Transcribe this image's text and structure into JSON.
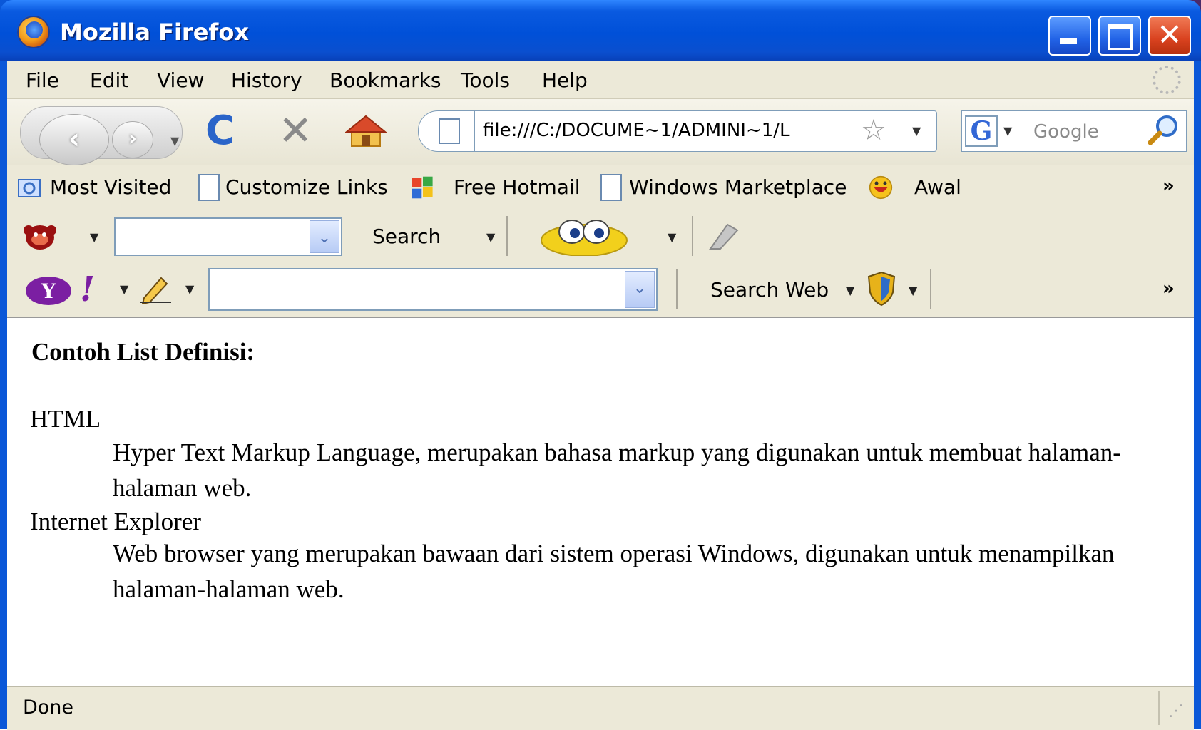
{
  "window": {
    "title": "Mozilla Firefox",
    "close_glyph": "✕"
  },
  "menu": {
    "items": [
      "File",
      "Edit",
      "View",
      "History",
      "Bookmarks",
      "Tools",
      "Help"
    ]
  },
  "nav": {
    "back_glyph": "‹",
    "forward_glyph": "›",
    "reload_glyph": "C",
    "stop_glyph": "✕",
    "url": "file:///C:/DOCUME~1/ADMINI~1/L",
    "star_glyph": "☆",
    "search_engine_glyph": "G",
    "search_placeholder": "Google"
  },
  "bookmarks": {
    "items": [
      "Most Visited",
      "Customize Links",
      "Free Hotmail",
      "Windows Marketplace",
      "Awal"
    ],
    "overflow": "»"
  },
  "toolbar1": {
    "search_label": "Search"
  },
  "toolbar2": {
    "search_web_label": "Search Web",
    "overflow": "»"
  },
  "content": {
    "heading": "Contoh List Definisi:",
    "definitions": [
      {
        "term": "HTML",
        "definition": "Hyper Text Markup Language, merupakan bahasa markup yang digunakan untuk membuat halaman-halaman web."
      },
      {
        "term": "Internet Explorer",
        "definition": "Web browser yang merupakan bawaan dari sistem operasi Windows, digunakan untuk menampilkan halaman-halaman web."
      }
    ]
  },
  "status": {
    "text": "Done"
  },
  "colors": {
    "titlebar": "#0a5ae0",
    "chrome": "#ece9d8",
    "close_button": "#d9421f"
  }
}
